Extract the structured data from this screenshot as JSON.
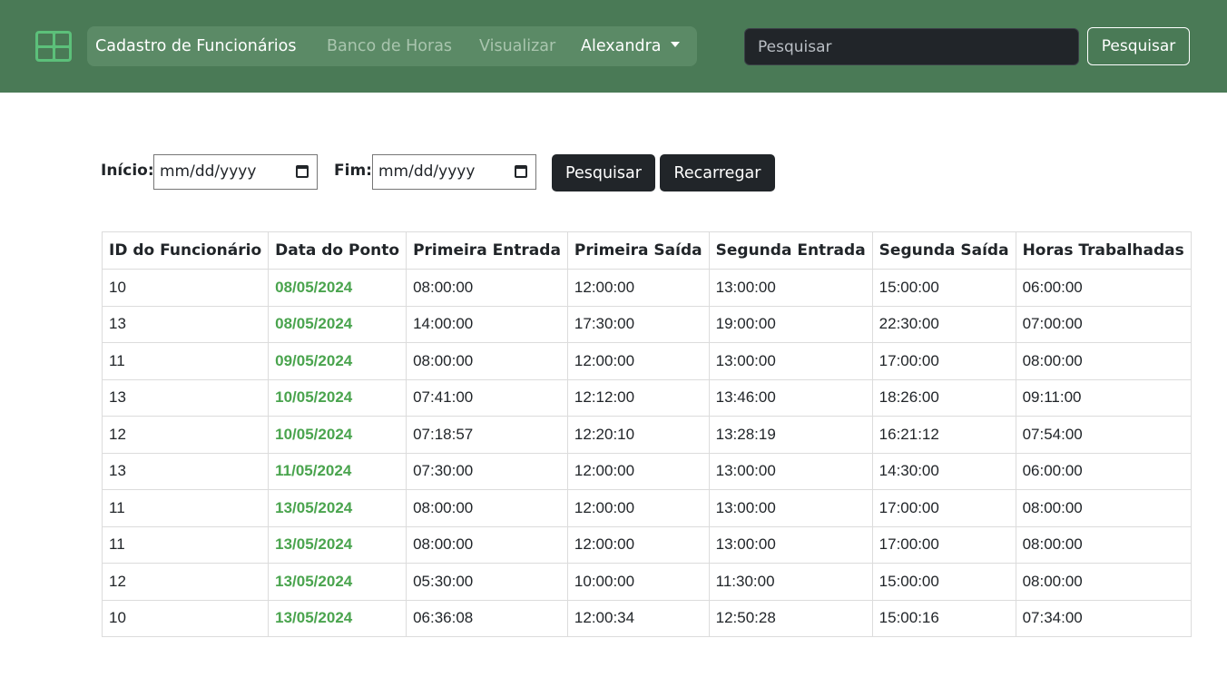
{
  "navbar": {
    "logo_icon": "table-grid-icon",
    "brand": "Cadastro de Funcionários",
    "links": [
      "Banco de Horas",
      "Visualizar"
    ],
    "user": "Alexandra",
    "search_placeholder": "Pesquisar",
    "search_button": "Pesquisar"
  },
  "filter": {
    "start_label": "Início:",
    "start_placeholder": "mm/dd/yyyy",
    "end_label": "Fim:",
    "end_placeholder": "mm/dd/yyyy",
    "search_button": "Pesquisar",
    "reload_button": "Recarregar"
  },
  "table": {
    "headers": [
      "ID do Funcionário",
      "Data do Ponto",
      "Primeira Entrada",
      "Primeira Saída",
      "Segunda Entrada",
      "Segunda Saída",
      "Horas Trabalhadas"
    ],
    "rows": [
      [
        "10",
        "08/05/2024",
        "08:00:00",
        "12:00:00",
        "13:00:00",
        "15:00:00",
        "06:00:00"
      ],
      [
        "13",
        "08/05/2024",
        "14:00:00",
        "17:30:00",
        "19:00:00",
        "22:30:00",
        "07:00:00"
      ],
      [
        "11",
        "09/05/2024",
        "08:00:00",
        "12:00:00",
        "13:00:00",
        "17:00:00",
        "08:00:00"
      ],
      [
        "13",
        "10/05/2024",
        "07:41:00",
        "12:12:00",
        "13:46:00",
        "18:26:00",
        "09:11:00"
      ],
      [
        "12",
        "10/05/2024",
        "07:18:57",
        "12:20:10",
        "13:28:19",
        "16:21:12",
        "07:54:00"
      ],
      [
        "13",
        "11/05/2024",
        "07:30:00",
        "12:00:00",
        "13:00:00",
        "14:30:00",
        "06:00:00"
      ],
      [
        "11",
        "13/05/2024",
        "08:00:00",
        "12:00:00",
        "13:00:00",
        "17:00:00",
        "08:00:00"
      ],
      [
        "11",
        "13/05/2024",
        "08:00:00",
        "12:00:00",
        "13:00:00",
        "17:00:00",
        "08:00:00"
      ],
      [
        "12",
        "13/05/2024",
        "05:30:00",
        "10:00:00",
        "11:30:00",
        "15:00:00",
        "08:00:00"
      ],
      [
        "10",
        "13/05/2024",
        "06:36:08",
        "12:00:34",
        "12:50:28",
        "15:00:16",
        "07:34:00"
      ]
    ]
  },
  "colors": {
    "navbar_bg": "#4a7a56",
    "date_text": "#4aa44e",
    "dark_button": "#212529"
  }
}
